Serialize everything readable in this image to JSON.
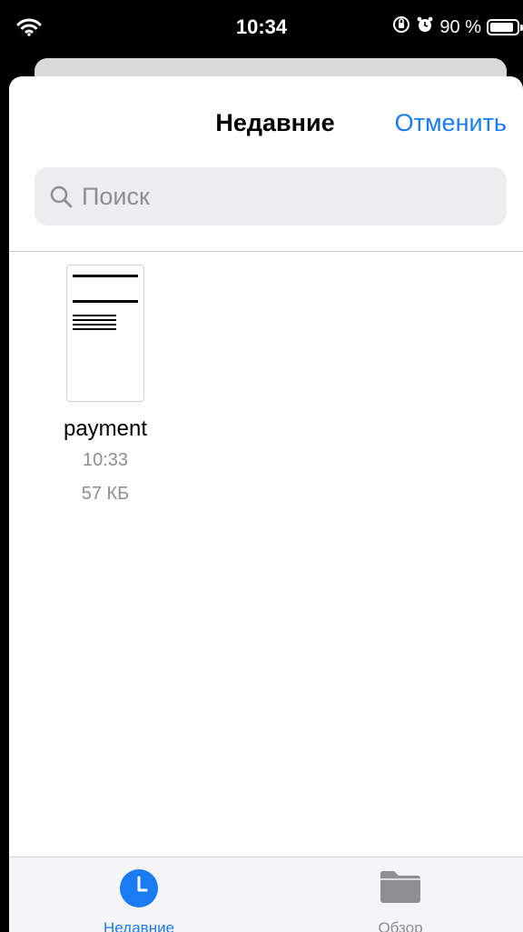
{
  "status_bar": {
    "time": "10:34",
    "battery_percent": "90 %",
    "battery_level": 0.9
  },
  "header": {
    "title": "Недавние",
    "cancel_label": "Отменить"
  },
  "search": {
    "placeholder": "Поиск",
    "value": ""
  },
  "files": [
    {
      "name": "payment",
      "time": "10:33",
      "size": "57 КБ"
    }
  ],
  "tab_bar": {
    "tabs": [
      {
        "label": "Недавние",
        "icon": "clock-icon",
        "selected": true
      },
      {
        "label": "Обзор",
        "icon": "folder-icon",
        "selected": false
      }
    ]
  },
  "colors": {
    "accent": "#1a7cf5",
    "secondary_text": "#8e8e93"
  }
}
